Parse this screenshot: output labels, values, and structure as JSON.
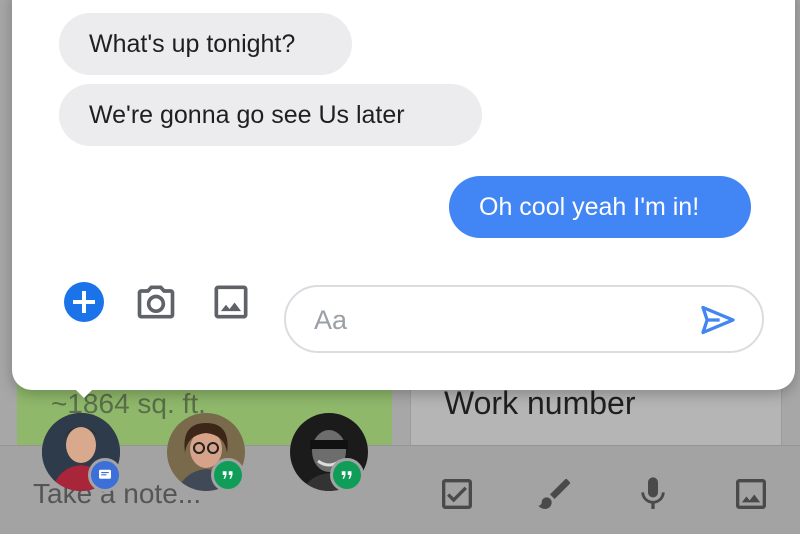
{
  "background": {
    "note_green_text": "~1864 sq. ft.",
    "note_white_text": "Work number",
    "take_note_placeholder": "Take a note...",
    "bar_icons": [
      "checkbox-icon",
      "brush-icon",
      "mic-icon",
      "image-icon"
    ]
  },
  "chat": {
    "messages": [
      {
        "direction": "incoming",
        "text": "What's up tonight?"
      },
      {
        "direction": "incoming",
        "text": "We're gonna go see Us later"
      },
      {
        "direction": "outgoing",
        "text": "Oh cool yeah I'm in!"
      }
    ],
    "input_placeholder": "Aa",
    "tools": [
      "add-icon",
      "camera-icon",
      "gallery-icon"
    ],
    "send_icon": "send-icon"
  },
  "chat_heads": [
    {
      "badge": "messages-badge",
      "badge_color": "#3c6fd8"
    },
    {
      "badge": "hangouts-badge",
      "badge_color": "#0f9d58"
    },
    {
      "badge": "hangouts-badge",
      "badge_color": "#0f9d58"
    }
  ],
  "colors": {
    "accent_blue": "#4285f4",
    "add_blue": "#1a73e8",
    "incoming_bubble": "#ececef",
    "hangouts_green": "#0f9d58"
  }
}
